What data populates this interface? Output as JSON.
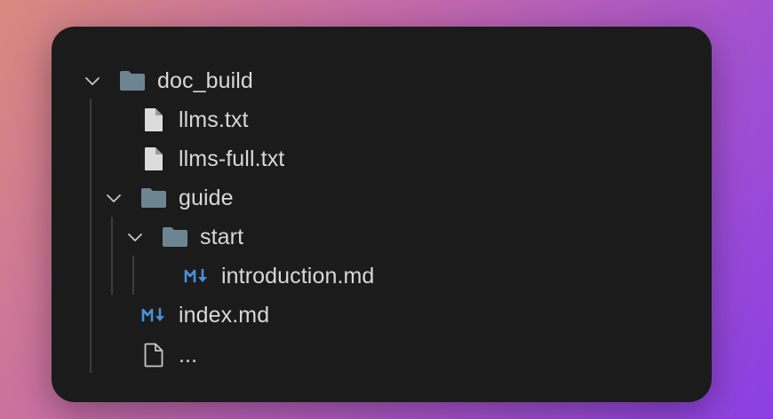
{
  "tree": {
    "root": {
      "label": "doc_build",
      "icon": "folder-icon",
      "expanded": true
    },
    "items": [
      {
        "label": "llms.txt",
        "icon": "file-icon"
      },
      {
        "label": "llms-full.txt",
        "icon": "file-icon"
      },
      {
        "label": "guide",
        "icon": "folder-icon",
        "expanded": true
      },
      {
        "label": "start",
        "icon": "folder-icon",
        "expanded": true
      },
      {
        "label": "introduction.md",
        "icon": "markdown-icon"
      },
      {
        "label": "index.md",
        "icon": "markdown-icon"
      },
      {
        "label": "...",
        "icon": "file-outline-icon"
      }
    ]
  },
  "colors": {
    "folder": "#6d8591",
    "file": "#dcdcdc",
    "markdown": "#4a8fd4",
    "text": "#d8d8d8",
    "chevron": "#c8c8c8",
    "guide_line": "#3d3d3f",
    "panel_bg": "#1b1b1c"
  }
}
